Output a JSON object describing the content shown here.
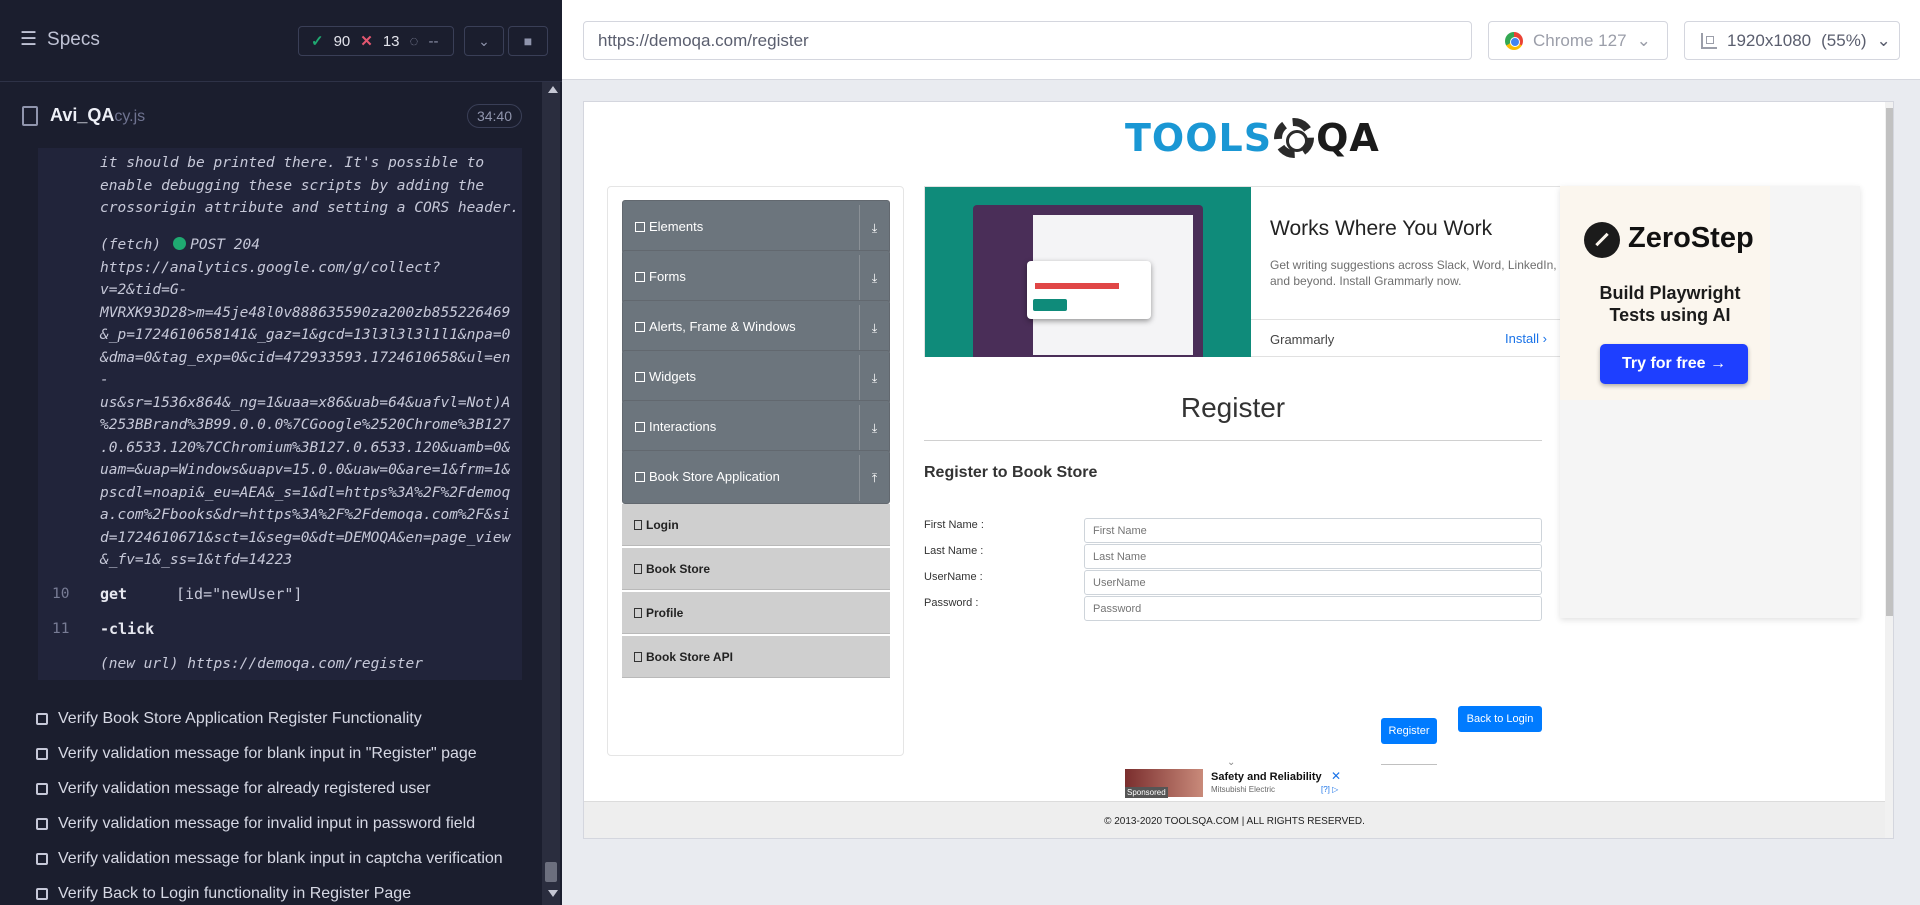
{
  "runner": {
    "specs_label": "Specs",
    "stats": {
      "passed": "90",
      "failed": "13",
      "pending": "--"
    },
    "spec": {
      "name": "Avi_QA",
      "ext": "cy.js",
      "time": "34:40"
    },
    "log_intro_lines": [
      "it should be printed there. It's possible to",
      "enable debugging these scripts by adding the",
      "crossorigin attribute and setting a CORS header."
    ],
    "fetch_prefix": "(fetch)",
    "fetch_method": "POST 204",
    "fetch_url_lines": [
      "https://analytics.google.com/g/collect?",
      "v=2&tid=G-",
      "MVRXK93D28>m=45je48l0v888635590za200zb855226469",
      "&_p=1724610658141&_gaz=1&gcd=13l3l3l3l1l1&npa=0",
      "&dma=0&tag_exp=0&cid=472933593.1724610658&ul=en",
      "-",
      "us&sr=1536x864&_ng=1&uaa=x86&uab=64&uafvl=Not)A",
      "%253BBrand%3B99.0.0.0%7CGoogle%2520Chrome%3B127",
      ".0.6533.120%7CChromium%3B127.0.6533.120&uamb=0&",
      "uam=&uap=Windows&uapv=15.0.0&uaw=0&are=1&frm=1&",
      "pscdl=noapi&_eu=AEA&_s=1&dl=https%3A%2F%2Fdemoq",
      "a.com%2Fbooks&dr=https%3A%2F%2Fdemoqa.com%2F&si",
      "d=1724610671&sct=1&seg=0&dt=DEMOQA&en=page_view",
      "&_fv=1&_ss=1&tfd=14223"
    ],
    "cmd_get": {
      "num": "10",
      "name": "get",
      "arg": "[id=\"newUser\"]"
    },
    "cmd_click": {
      "num": "11",
      "name": "-click"
    },
    "new_url": "(new url)  https://demoqa.com/register",
    "tests": [
      "Verify Book Store Application Register Functionality",
      "Verify validation message for blank input in \"Register\" page",
      "Verify validation message for already registered user",
      "Verify validation message for invalid input in password field",
      "Verify validation message for blank input in captcha verification",
      "Verify Back to Login functionality in Register Page"
    ]
  },
  "aut": {
    "url": "https://demoqa.com/register",
    "browser": "Chrome 127",
    "viewport": "1920x1080",
    "zoom": "(55%)"
  },
  "site": {
    "logo_tools": "TOOLS",
    "logo_qa": "QA",
    "groups": [
      "Elements",
      "Forms",
      "Alerts, Frame & Windows",
      "Widgets",
      "Interactions",
      "Book Store Application"
    ],
    "book_items": [
      "Login",
      "Book Store",
      "Profile",
      "Book Store API"
    ],
    "ad": {
      "title": "Works Where You Work",
      "desc": "Get writing suggestions across Slack, Word, LinkedIn, and beyond. Install Grammarly now.",
      "brand": "Grammarly",
      "install": "Install"
    },
    "register_title": "Register",
    "register_sub": "Register to Book Store",
    "fields": [
      {
        "label": "First Name :",
        "placeholder": "First Name"
      },
      {
        "label": "Last Name :",
        "placeholder": "Last Name"
      },
      {
        "label": "UserName :",
        "placeholder": "UserName"
      },
      {
        "label": "Password :",
        "placeholder": "Password"
      }
    ],
    "register_btn": "Register",
    "back_btn": "Back to Login",
    "side_ad": {
      "name": "ZeroStep",
      "tagline": "Build Playwright Tests using AI",
      "cta": "Try for free →"
    },
    "bottom_ad": {
      "title": "Safety and Reliability",
      "sub": "Mitsubishi Electric",
      "sponsored": "Sponsored"
    },
    "footer": "© 2013-2020 TOOLSQA.COM | ALL RIGHTS RESERVED."
  }
}
